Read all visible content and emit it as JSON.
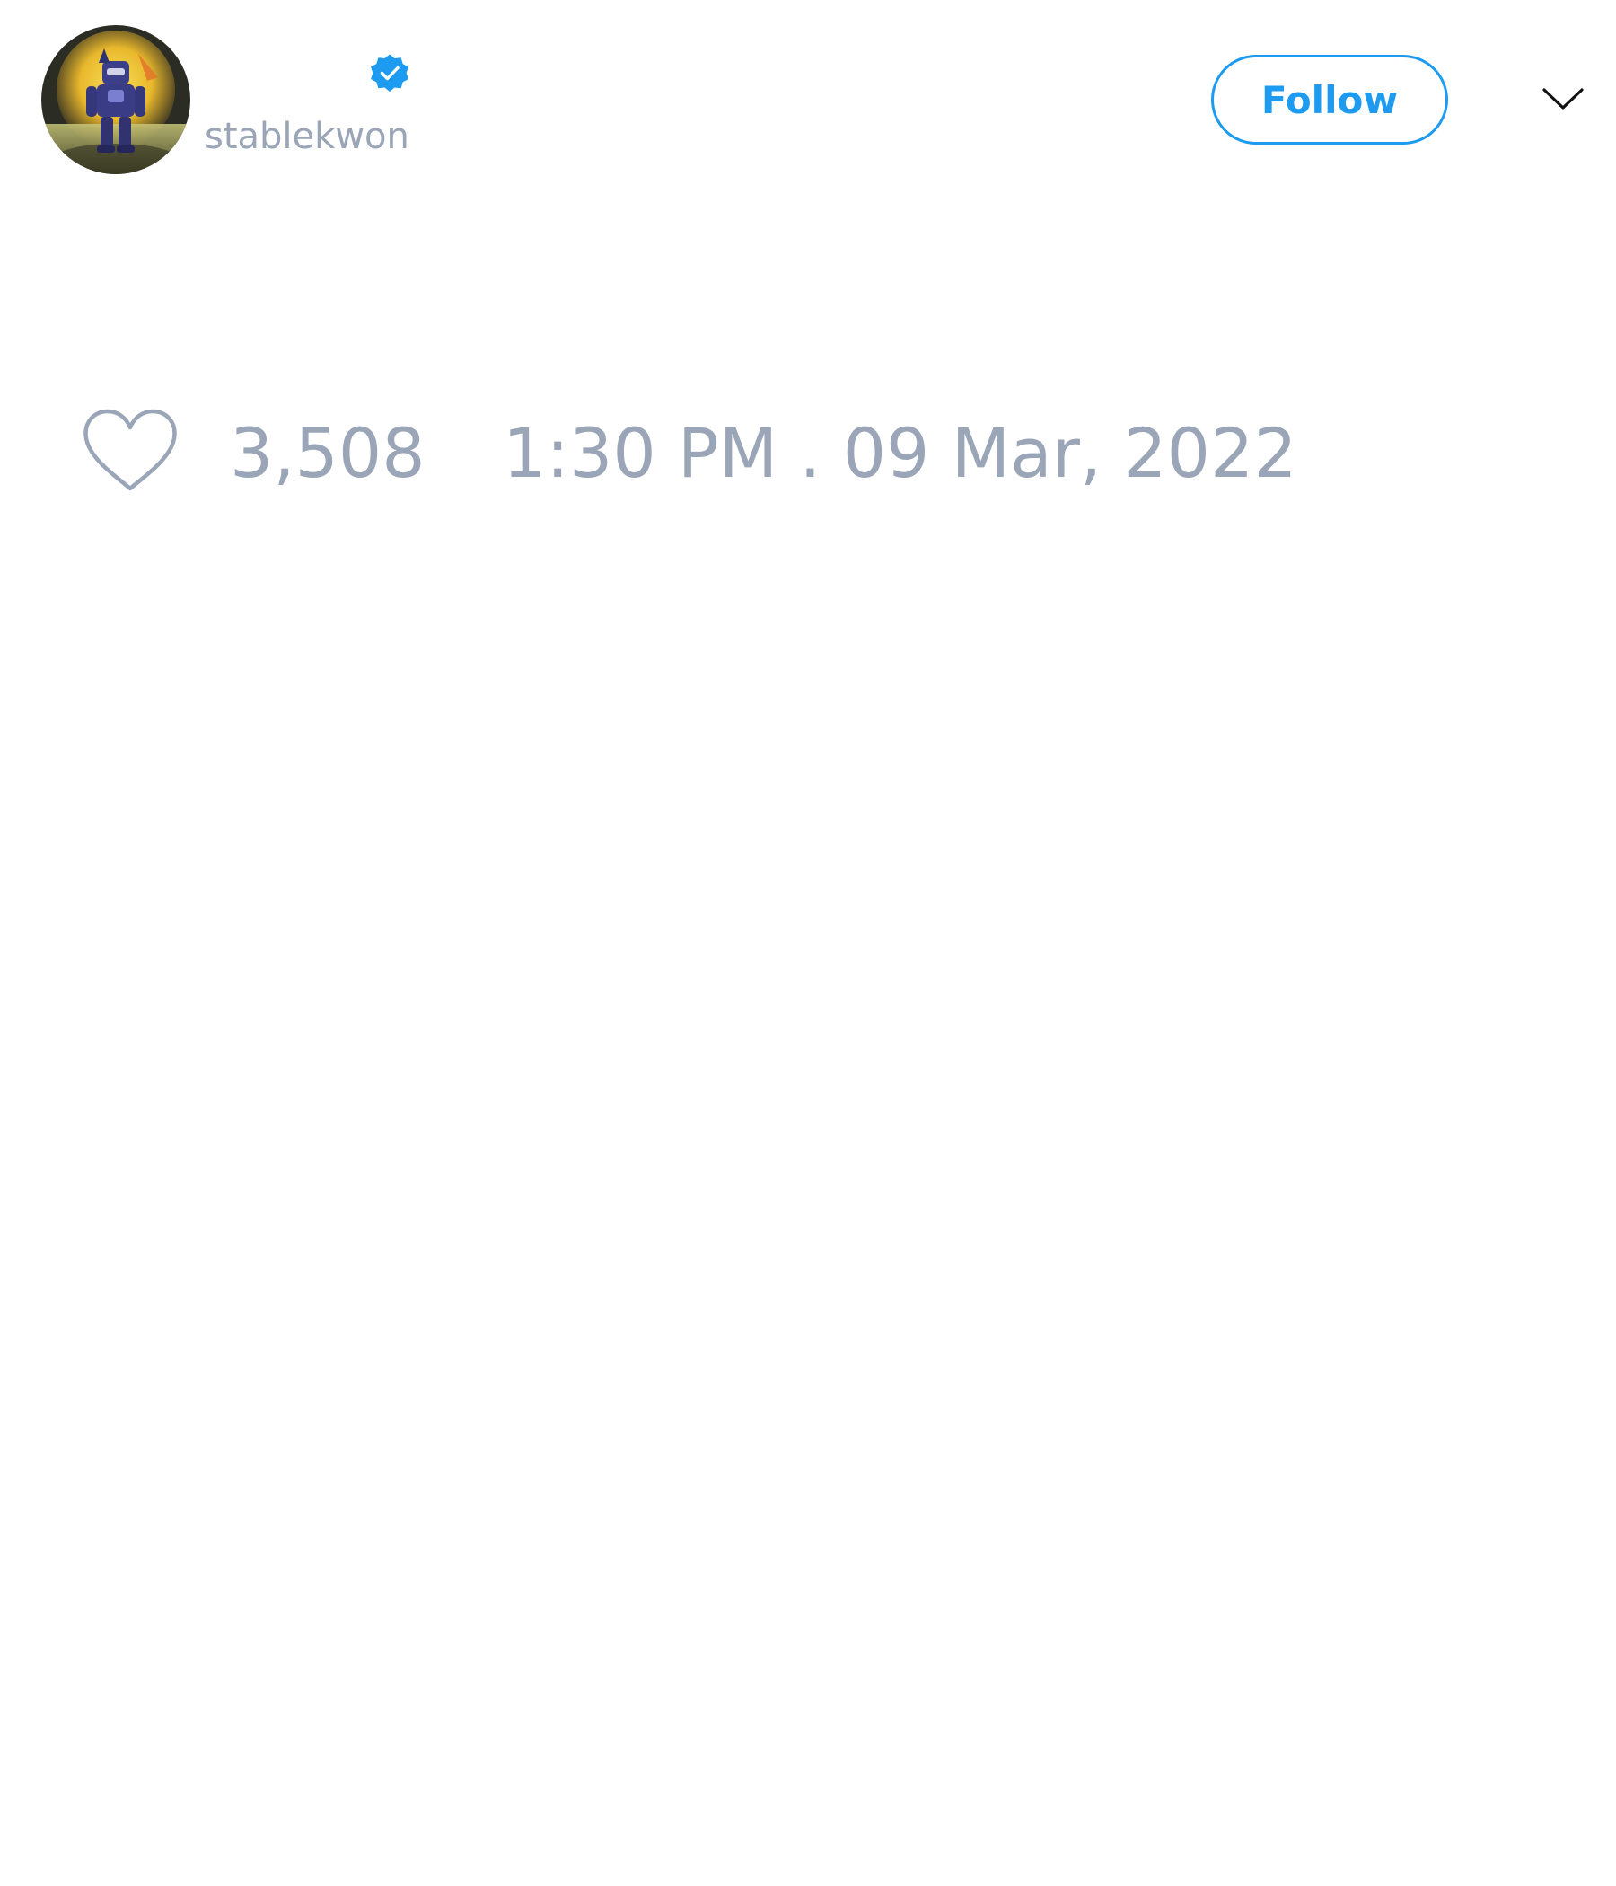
{
  "tweet": {
    "author": {
      "handle": "stablekwon",
      "verified": true,
      "avatar_icon": "robot-avatar-icon"
    },
    "follow_label": "Follow",
    "menu_icon": "chevron-down-icon",
    "likes": "3,508",
    "like_icon": "heart-icon",
    "timestamp": "1:30 PM . 09 Mar, 2022"
  },
  "colors": {
    "accent": "#1d9bf0",
    "muted_text": "#9aa5b7",
    "background": "#ffffff"
  }
}
